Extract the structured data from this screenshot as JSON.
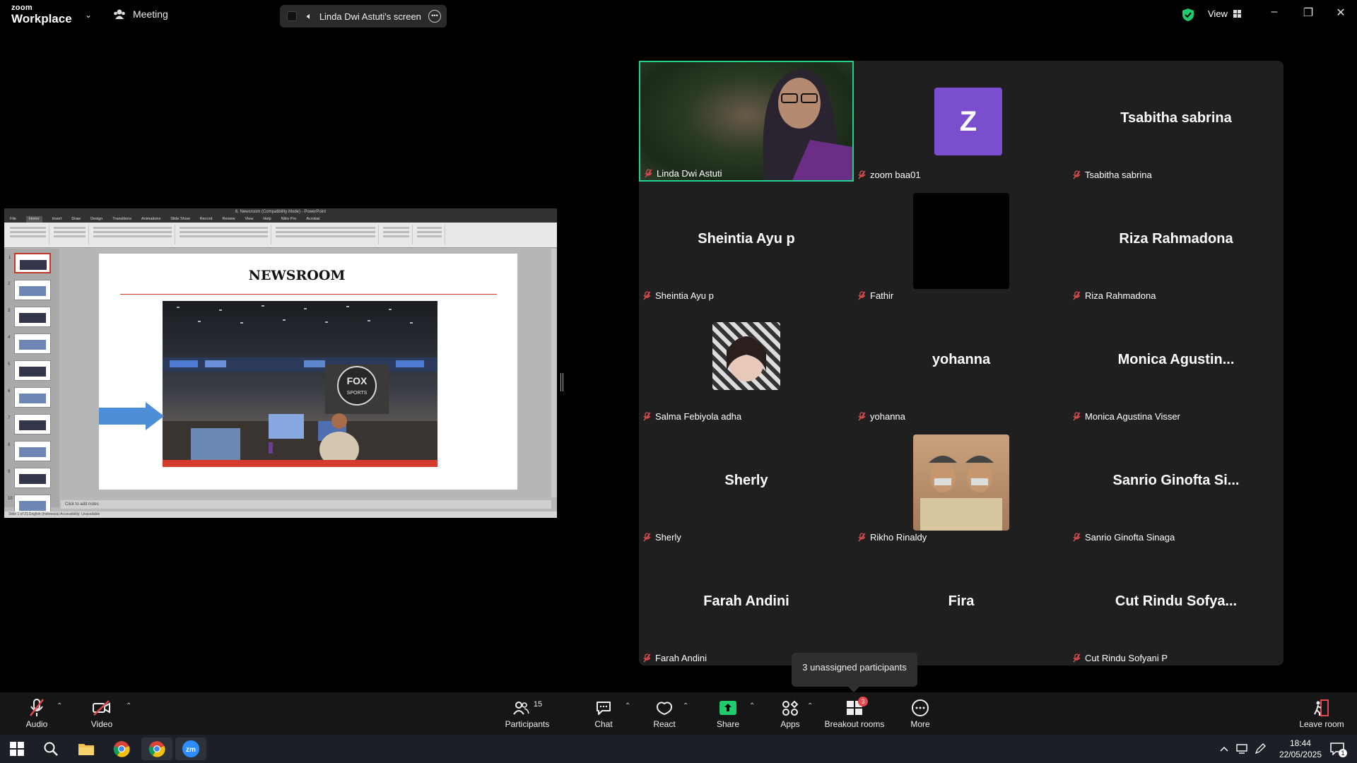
{
  "topbar": {
    "brand_line1": "zoom",
    "brand_line2": "Workplace",
    "meeting_label": "Meeting",
    "screen_label": "Linda Dwi Astuti's screen",
    "view_label": "View"
  },
  "shared_screen": {
    "window_title": "6. Newsroom (Compatibility Mode) - PowerPoint",
    "menu_tabs": [
      "File",
      "Home",
      "Insert",
      "Draw",
      "Design",
      "Transitions",
      "Animations",
      "Slide Show",
      "Record",
      "Review",
      "View",
      "Help",
      "Nitro Pro",
      "Acrobat"
    ],
    "slide_title": "NEWSROOM",
    "photo_logo": "FOX SPORTS",
    "notes_placeholder": "Click to add notes",
    "status_text": "Slide 1 of 21   English (Indonesia)   Accessibility: Unavailable",
    "thumb_numbers": [
      "1",
      "2",
      "3",
      "4",
      "5",
      "6",
      "7",
      "8",
      "9",
      "10"
    ]
  },
  "participants": [
    {
      "display": "",
      "name": "Linda Dwi Astuti",
      "type": "video"
    },
    {
      "display": "Z",
      "name": "zoom baa01",
      "type": "avatar-letter",
      "avatar_color": "#7b4ecf"
    },
    {
      "display": "Tsabitha sabrina",
      "name": "Tsabitha sabrina",
      "type": "text"
    },
    {
      "display": "Sheintia Ayu p",
      "name": "Sheintia Ayu p",
      "type": "text"
    },
    {
      "display": "",
      "name": "Fathir",
      "type": "avatar-black"
    },
    {
      "display": "Riza Rahmadona",
      "name": "Riza Rahmadona",
      "type": "text"
    },
    {
      "display": "",
      "name": "Salma Febiyola adha",
      "type": "avatar-photo"
    },
    {
      "display": "yohanna",
      "name": "yohanna",
      "type": "text"
    },
    {
      "display": "Monica  Agustin...",
      "name": "Monica Agustina Visser",
      "type": "text"
    },
    {
      "display": "Sherly",
      "name": "Sherly",
      "type": "text"
    },
    {
      "display": "",
      "name": "Rikho Rinaldy",
      "type": "avatar-photo2"
    },
    {
      "display": "Sanrio Ginofta Si...",
      "name": "Sanrio Ginofta Sinaga",
      "type": "text"
    },
    {
      "display": "Farah Andini",
      "name": "Farah Andini",
      "type": "text"
    },
    {
      "display": "Fira",
      "name": "Fira",
      "type": "text-noname"
    },
    {
      "display": "Cut  Rindu  Sofya...",
      "name": "Cut Rindu Sofyani P",
      "type": "text"
    }
  ],
  "tooltip": "3 unassigned participants",
  "toolbar": {
    "audio": "Audio",
    "video": "Video",
    "participants": "Participants",
    "participants_count": "15",
    "chat": "Chat",
    "react": "React",
    "share": "Share",
    "apps": "Apps",
    "breakout": "Breakout rooms",
    "breakout_badge": "3",
    "more": "More",
    "leave": "Leave room"
  },
  "taskbar": {
    "time": "18:44",
    "date": "22/05/2025",
    "notif_count": "1"
  },
  "colors": {
    "active_speaker": "#23d18b",
    "share_green": "#1fcb6a",
    "muted_red": "#e5484d",
    "gallery_bg": "#1f1f1f"
  }
}
